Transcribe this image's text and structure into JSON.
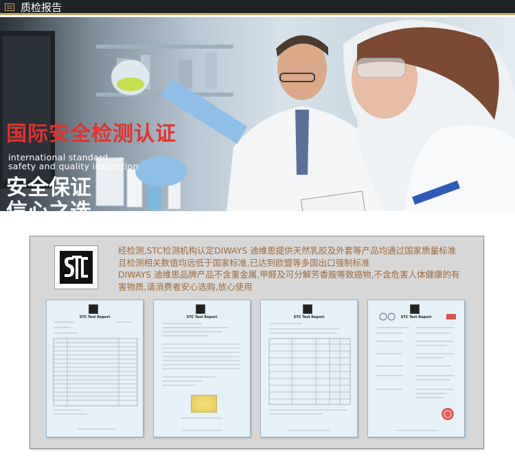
{
  "header": {
    "title": "质检报告"
  },
  "hero": {
    "title": "国际安全检测认证",
    "subtitle_line1": "international standard",
    "subtitle_line2": "safety and quality inspection",
    "slogan_line1": "安全保证",
    "slogan_line2": "信心之选"
  },
  "panel": {
    "text_lines": [
      "经检测,STC检测机构认定DIWAYS 迪维思提供天然乳胶及外套等产品均通过国家质量标准",
      "且检测相关数值均远低于国家标准,已达到欧盟等多国出口强制标准",
      "DIWAYS 迪维思品牌产品不含重金属,甲醛及可分解芳香胺等致癌物,不含危害人体健康的有",
      "害物质,请消费者安心选购,放心使用"
    ],
    "reports": [
      {
        "title": "STC Test Report"
      },
      {
        "title": "STC Test Report"
      },
      {
        "title": "STC Test Report"
      },
      {
        "title": "STC Test Report"
      }
    ]
  },
  "colors": {
    "header_bg": "#1e2327",
    "header_accent": "#c9a860",
    "hero_title": "#e5312a",
    "panel_text": "#9f6a3c"
  }
}
